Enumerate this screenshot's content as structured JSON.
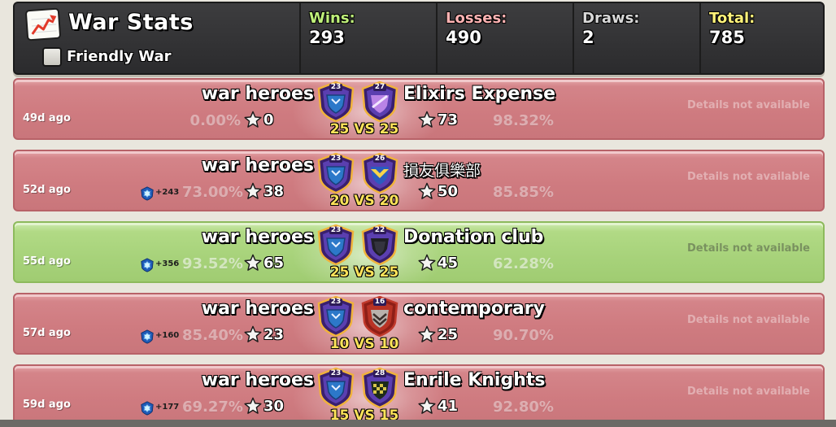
{
  "header": {
    "title": "War Stats",
    "friendly_label": "Friendly War",
    "friendly_checked": false,
    "stats": [
      {
        "label": "Wins:",
        "value": "293",
        "color": "#bff07a"
      },
      {
        "label": "Losses:",
        "value": "490",
        "color": "#ffb3b3"
      },
      {
        "label": "Draws:",
        "value": "2",
        "color": "#d8d8d8"
      },
      {
        "label": "Total:",
        "value": "785",
        "color": "#fff27a"
      }
    ]
  },
  "rows": [
    {
      "result": "loss",
      "age": "49d ago",
      "our_name": "war heroes",
      "opp_name": "Elixirs Expense",
      "opp_cjk": false,
      "our_level": "23",
      "opp_level": "27",
      "opp_badge": "stripe",
      "score": "25 VS 25",
      "our_pct": "0.00%",
      "our_stars": "0",
      "opp_pct": "98.32%",
      "opp_stars": "73",
      "xp": "",
      "details": "Details not available"
    },
    {
      "result": "loss",
      "age": "52d ago",
      "our_name": "war heroes",
      "opp_name": "損友俱樂部",
      "opp_cjk": true,
      "our_level": "23",
      "opp_level": "26",
      "opp_badge": "wings",
      "score": "20 VS 20",
      "our_pct": "73.00%",
      "our_stars": "38",
      "opp_pct": "85.85%",
      "opp_stars": "50",
      "xp": "+243",
      "details": "Details not available"
    },
    {
      "result": "win",
      "age": "55d ago",
      "our_name": "war heroes",
      "opp_name": "Donation club",
      "opp_cjk": false,
      "our_level": "23",
      "opp_level": "22",
      "opp_badge": "dark",
      "score": "25 VS 25",
      "our_pct": "93.52%",
      "our_stars": "65",
      "opp_pct": "62.28%",
      "opp_stars": "45",
      "xp": "+356",
      "details": "Details not available"
    },
    {
      "result": "loss",
      "age": "57d ago",
      "our_name": "war heroes",
      "opp_name": "contemporary",
      "opp_cjk": false,
      "our_level": "23",
      "opp_level": "16",
      "opp_badge": "chevron",
      "score": "10 VS 10",
      "our_pct": "85.40%",
      "our_stars": "23",
      "opp_pct": "90.70%",
      "opp_stars": "25",
      "xp": "+160",
      "details": "Details not available"
    },
    {
      "result": "loss",
      "age": "59d ago",
      "our_name": "war heroes",
      "opp_name": "Enrile Knights",
      "opp_cjk": false,
      "our_level": "23",
      "opp_level": "28",
      "opp_badge": "check",
      "score": "15 VS 15",
      "our_pct": "69.27%",
      "our_stars": "30",
      "opp_pct": "92.80%",
      "opp_stars": "41",
      "xp": "+177",
      "details": "Details not available"
    }
  ]
}
